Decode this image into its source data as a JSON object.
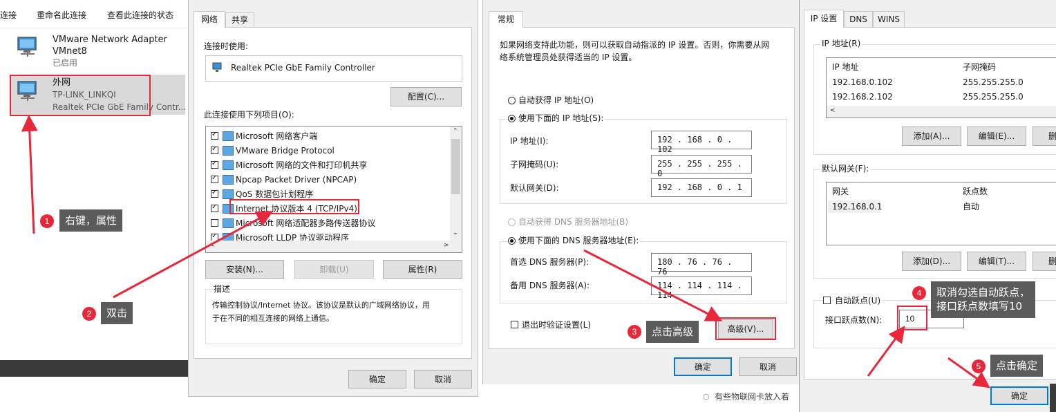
{
  "netconn": {
    "toolbar": [
      "连接",
      "重命名此连接",
      "查看此连接的状态"
    ],
    "adapters": [
      {
        "name": "VMware Network Adapter",
        "sub1": "VMnet8",
        "sub2": "已启用"
      },
      {
        "name": "外网",
        "sub1": "TP-LINK_LINKQI",
        "sub2": "Realtek PCIe GbE Family Contr..."
      }
    ]
  },
  "props": {
    "tabs": [
      "网络",
      "共享"
    ],
    "connect_using_label": "连接时使用:",
    "adapter": "Realtek PCIe GbE Family Controller",
    "configure": "配置(C)...",
    "items_label": "此连接使用下列项目(O):",
    "items": [
      {
        "label": "Microsoft 网络客户端",
        "checked": true
      },
      {
        "label": "VMware Bridge Protocol",
        "checked": true
      },
      {
        "label": "Microsoft 网络的文件和打印机共享",
        "checked": true
      },
      {
        "label": "Npcap Packet Driver (NPCAP)",
        "checked": true
      },
      {
        "label": "QoS 数据包计划程序",
        "checked": true
      },
      {
        "label": "Internet 协议版本 4 (TCP/IPv4)",
        "checked": true
      },
      {
        "label": "Microsoft 网络适配器多路传送器协议",
        "checked": false
      },
      {
        "label": "Microsoft LLDP 协议驱动程序",
        "checked": true
      }
    ],
    "install": "安装(N)...",
    "uninstall": "卸载(U)",
    "properties": "属性(R)",
    "desc_title": "描述",
    "desc_text1": "传输控制协议/Internet 协议。该协议是默认的广域网络协议，用",
    "desc_text2": "于在不同的相互连接的网络上通信。",
    "ok": "确定",
    "cancel": "取消"
  },
  "ipv4": {
    "tab": "常规",
    "intro1": "如果网络支持此功能，则可以获取自动指派的 IP 设置。否则，你需要从网",
    "intro2": "络系统管理员处获得适当的 IP 设置。",
    "auto_ip": "自动获得 IP 地址(O)",
    "manual_ip": "使用下面的 IP 地址(S):",
    "ip_label": "IP 地址(I):",
    "ip_value": "192 . 168 .  0  . 102",
    "mask_label": "子网掩码(U):",
    "mask_value": "255 . 255 . 255 .  0",
    "gw_label": "默认网关(D):",
    "gw_value": "192 . 168 .  0  .  1",
    "auto_dns": "自动获得 DNS 服务器地址(B)",
    "manual_dns": "使用下面的 DNS 服务器地址(E):",
    "dns1_label": "首选 DNS 服务器(P):",
    "dns1_value": "180 . 76  . 76  . 76",
    "dns2_label": "备用 DNS 服务器(A):",
    "dns2_value": "114 . 114 . 114 . 114",
    "validate": "退出时验证设置(L)",
    "advanced": "高级(V)...",
    "ok": "确定",
    "cancel": "取消",
    "side_text": "有些物联网卡放入着"
  },
  "adv": {
    "tabs": [
      "IP 设置",
      "DNS",
      "WINS"
    ],
    "ip_group": "IP 地址(R)",
    "ip_col1": "IP 地址",
    "ip_col2": "子网掩码",
    "ip_rows": [
      [
        "192.168.0.102",
        "255.255.255.0"
      ],
      [
        "192.168.2.102",
        "255.255.255.0"
      ]
    ],
    "add": "添加(A)...",
    "edit": "编辑(E)...",
    "del": "删",
    "gw_group": "默认网关(F):",
    "gw_col1": "网关",
    "gw_col2": "跃点数",
    "gw_rows": [
      [
        "192.168.0.1",
        "自动"
      ]
    ],
    "add2": "添加(D)...",
    "edit2": "编辑(T)...",
    "del2": "删",
    "auto_metric": "自动跃点(U)",
    "metric_label": "接口跃点数(N):",
    "metric_value": "10",
    "ok": "确定"
  },
  "annotations": {
    "n1": "1",
    "s1": "右键，属性",
    "n2": "2",
    "s2": "双击",
    "n3": "3",
    "s3": "点击高级",
    "n4": "4",
    "s4a": "取消勾选自动跃点，",
    "s4b": "接口跃点数填写10",
    "n5": "5",
    "s5": "点击确定"
  },
  "colors": {
    "highlight": "#e8283a",
    "accent": "#0078d7",
    "dialog_bg": "#f0f0f0"
  }
}
